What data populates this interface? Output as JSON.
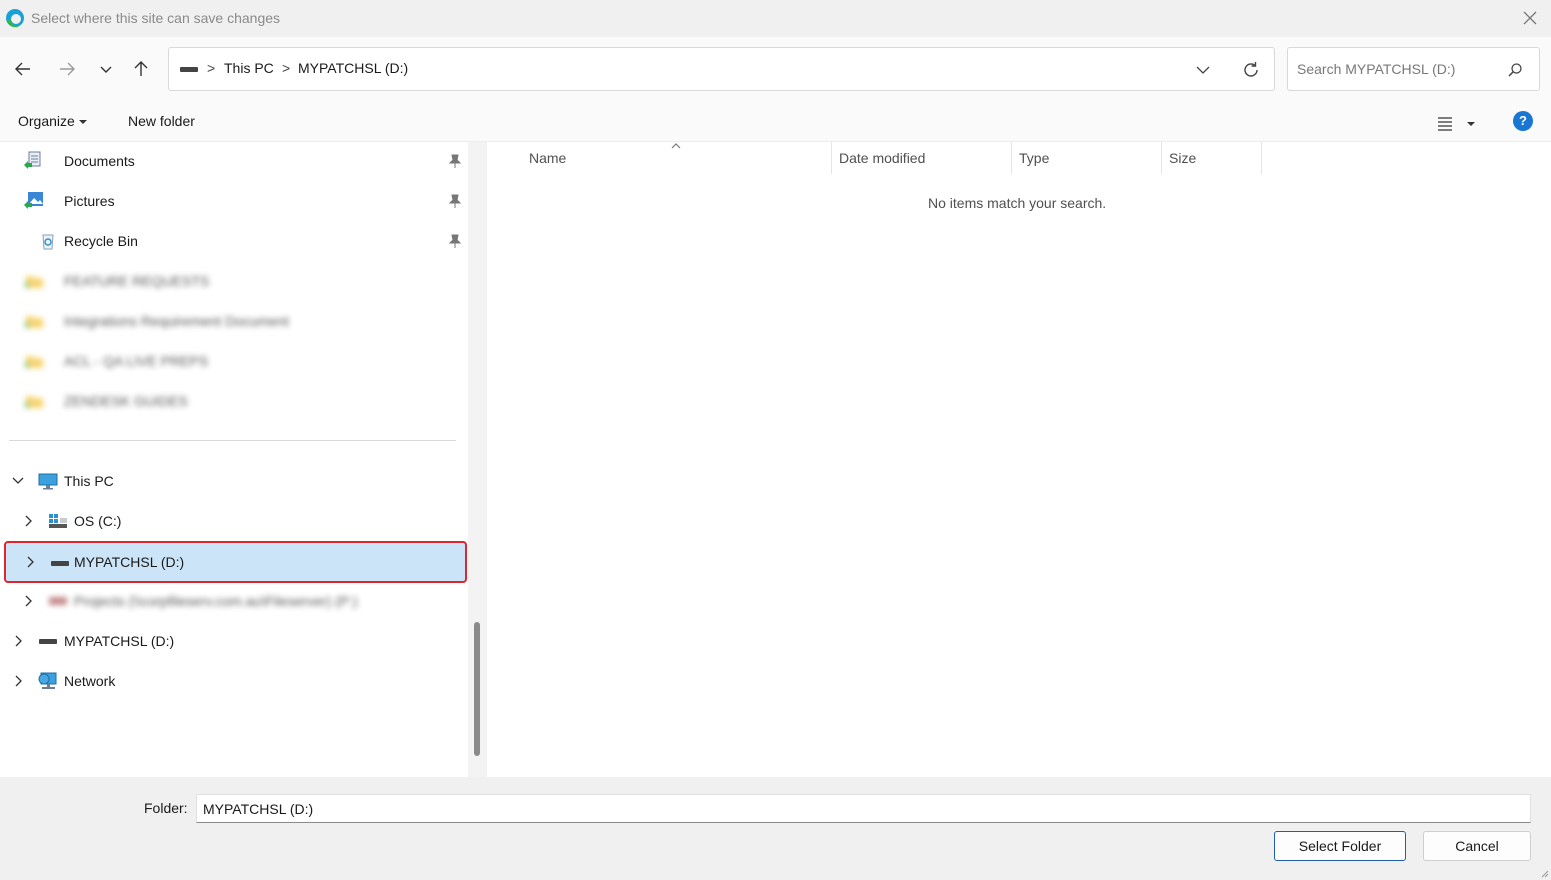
{
  "window": {
    "title": "Select where this site can save changes",
    "app_icon": "edge-browser-icon",
    "close_icon": "close-icon"
  },
  "nav": {
    "back_icon": "arrow-left-icon",
    "forward_icon": "arrow-right-icon",
    "recent_icon": "chevron-down-icon",
    "up_icon": "arrow-up-icon"
  },
  "address": {
    "crumbs": [
      "This PC",
      "MYPATCHSL (D:)"
    ],
    "separator": ">"
  },
  "search": {
    "placeholder": "Search MYPATCHSL (D:)"
  },
  "toolbar": {
    "organize_label": "Organize",
    "new_folder_label": "New folder",
    "help_label": "?"
  },
  "sidebar": {
    "quick_access": [
      {
        "label": "Documents",
        "icon": "documents-icon",
        "pinned": true
      },
      {
        "label": "Pictures",
        "icon": "pictures-icon",
        "pinned": true
      },
      {
        "label": "Recycle Bin",
        "icon": "recycle-bin-icon",
        "pinned": true
      },
      {
        "label": "FEATURE REQUESTS",
        "icon": "folder-icon",
        "blurred": true
      },
      {
        "label": "Integrations Requirement Document",
        "icon": "folder-icon",
        "blurred": true
      },
      {
        "label": "ACL - QA LIVE PREPS",
        "icon": "folder-icon",
        "blurred": true
      },
      {
        "label": "ZENDESK GUIDES",
        "icon": "folder-icon",
        "blurred": true
      }
    ],
    "tree": [
      {
        "label": "This PC",
        "icon": "computer-icon",
        "expanded": true
      },
      {
        "label": "OS (C:)",
        "icon": "windows-drive-icon"
      },
      {
        "label": "MYPATCHSL (D:)",
        "icon": "drive-icon",
        "selected": true
      },
      {
        "label": "Projects (\\\\corpfileserv.com.au\\Fileserver) (P:)",
        "icon": "network-drive-icon",
        "blurred": true
      },
      {
        "label": "MYPATCHSL (D:)",
        "icon": "drive-icon"
      },
      {
        "label": "Network",
        "icon": "network-icon"
      }
    ]
  },
  "columns": [
    "Name",
    "Date modified",
    "Type",
    "Size"
  ],
  "empty_message": "No items match your search.",
  "footer": {
    "folder_label": "Folder:",
    "folder_value": "MYPATCHSL (D:)",
    "select_button": "Select Folder",
    "cancel_button": "Cancel"
  },
  "colors": {
    "selection_bg": "#cce4f7",
    "selection_outline": "#e0262c",
    "accent": "#1976d2"
  }
}
